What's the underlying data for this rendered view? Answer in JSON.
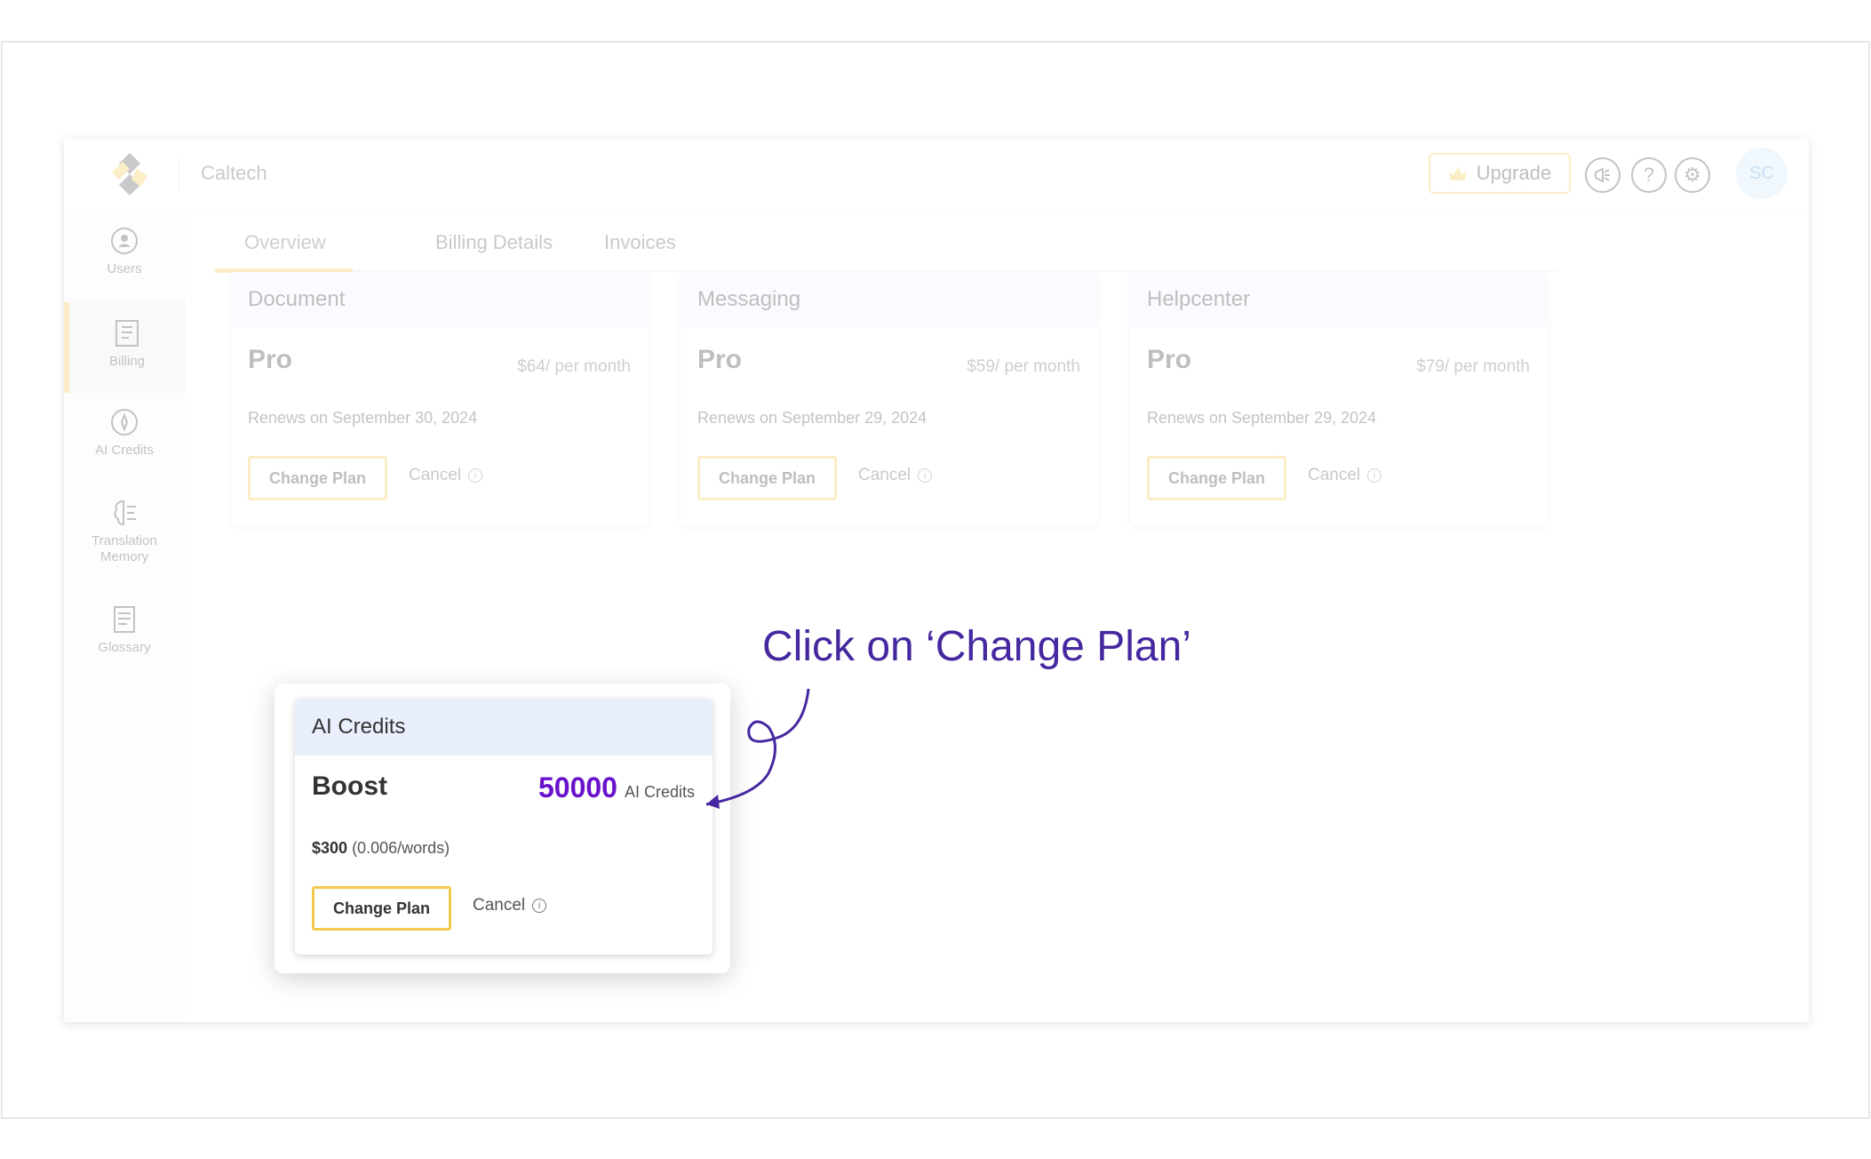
{
  "header": {
    "org_name": "Caltech",
    "upgrade_label": "Upgrade",
    "avatar_initials": "SC",
    "icons": [
      "announcement-icon",
      "help-icon",
      "settings-icon"
    ]
  },
  "sidebar": {
    "items": [
      {
        "label": "Users",
        "icon": "users-icon"
      },
      {
        "label": "Billing",
        "icon": "billing-icon",
        "active": true
      },
      {
        "label": "AI Credits",
        "icon": "ai-credits-icon"
      },
      {
        "label": "Translation Memory",
        "icon": "translation-memory-icon"
      },
      {
        "label": "Glossary",
        "icon": "glossary-icon"
      }
    ]
  },
  "tabs": [
    {
      "label": "Overview",
      "active": true
    },
    {
      "label": "Billing Details"
    },
    {
      "label": "Invoices"
    }
  ],
  "plans": [
    {
      "title": "Document",
      "plan": "Pro",
      "price": "$64/ per month",
      "renews": "Renews on September 30, 2024",
      "change_label": "Change Plan",
      "cancel_label": "Cancel"
    },
    {
      "title": "Messaging",
      "plan": "Pro",
      "price": "$59/ per month",
      "renews": "Renews on September 29, 2024",
      "change_label": "Change Plan",
      "cancel_label": "Cancel"
    },
    {
      "title": "Helpcenter",
      "plan": "Pro",
      "price": "$79/ per month",
      "renews": "Renews on September 29, 2024",
      "change_label": "Change Plan",
      "cancel_label": "Cancel"
    }
  ],
  "ai_credits": {
    "title": "AI Credits",
    "plan": "Boost",
    "credits": "50000",
    "credits_unit": "AI Credits",
    "price": "$300",
    "rate": "(0.006/words)",
    "change_label": "Change Plan",
    "cancel_label": "Cancel"
  },
  "callout": "Click on ‘Change Plan’",
  "colors": {
    "accent": "#f2c94c",
    "callout": "#4527a0",
    "credits": "#6a11cb"
  }
}
